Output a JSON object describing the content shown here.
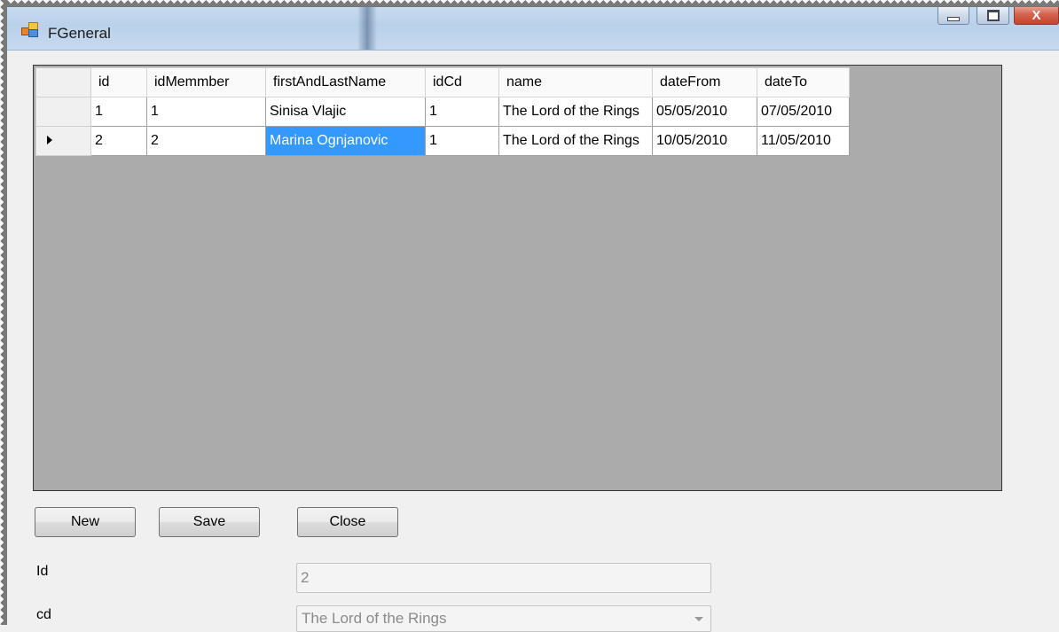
{
  "window": {
    "title": "FGeneral",
    "close_glyph": "X"
  },
  "grid": {
    "columns": [
      "id",
      "idMemmber",
      "firstAndLastName",
      "idCd",
      "name",
      "dateFrom",
      "dateTo"
    ],
    "rows": [
      {
        "id": "1",
        "idMemmber": "1",
        "firstAndLastName": "Sinisa Vlajic",
        "idCd": "1",
        "name": "The Lord of the Rings",
        "dateFrom": "05/05/2010",
        "dateTo": "07/05/2010"
      },
      {
        "id": "2",
        "idMemmber": "2",
        "firstAndLastName": "Marina Ognjanovic",
        "idCd": "1",
        "name": "The Lord of the Rings",
        "dateFrom": "10/05/2010",
        "dateTo": "11/05/2010"
      }
    ],
    "current_row_index": 1
  },
  "buttons": {
    "new": "New",
    "save": "Save",
    "close": "Close"
  },
  "form": {
    "id_label": "Id",
    "id_value": "2",
    "cd_label": "cd",
    "cd_value": "The Lord of the Rings"
  },
  "colors": {
    "selection": "#3399ff",
    "close_button": "#c5432f"
  }
}
